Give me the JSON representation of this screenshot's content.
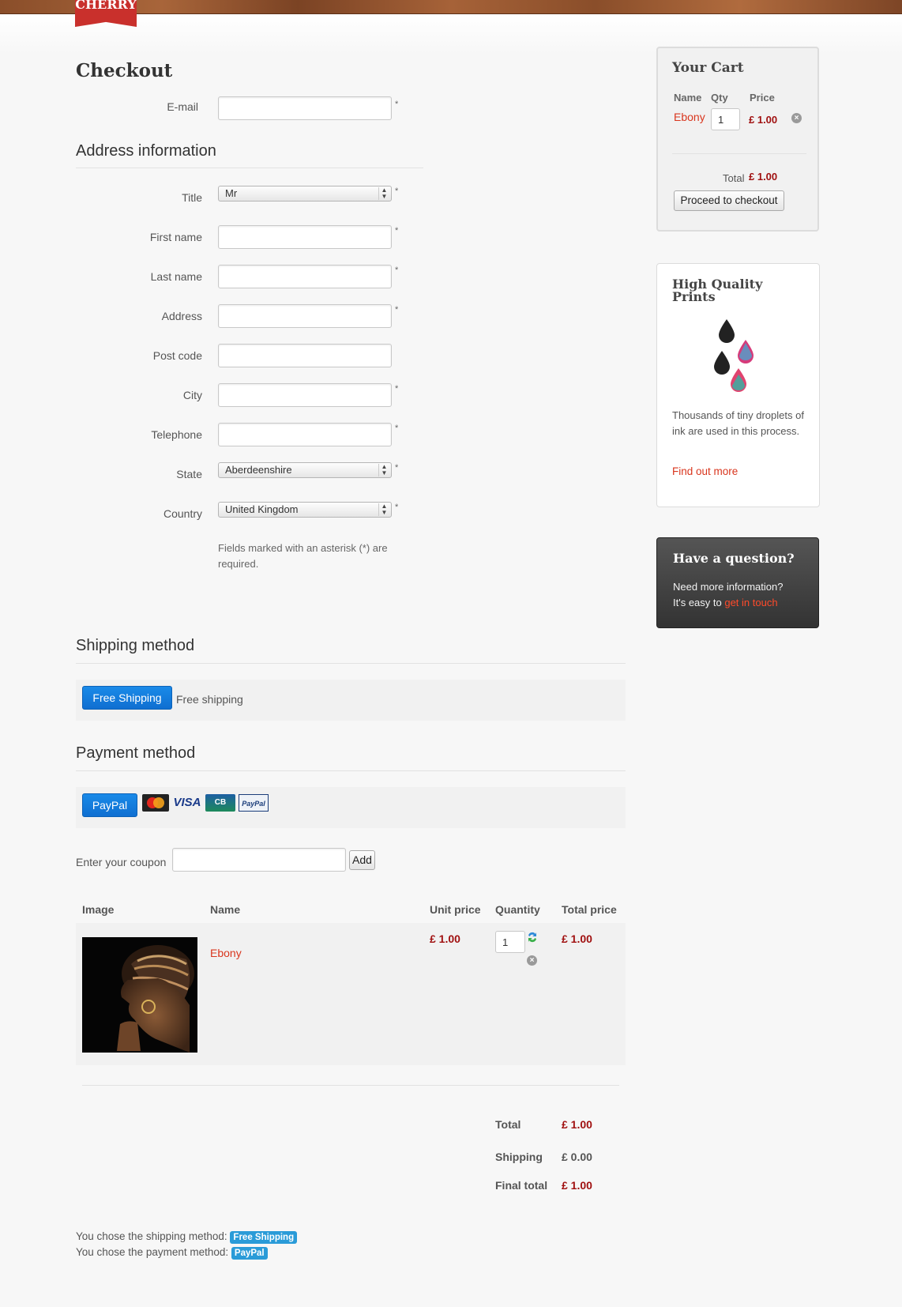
{
  "brand": {
    "logo_text": "CHERRY"
  },
  "checkout": {
    "title": "Checkout",
    "email_label": "E-mail",
    "email_value": ""
  },
  "address": {
    "heading": "Address information",
    "fields": [
      {
        "label": "Title",
        "type": "select",
        "value": "Mr",
        "required": true
      },
      {
        "label": "First name",
        "type": "text",
        "value": "",
        "required": true
      },
      {
        "label": "Last name",
        "type": "text",
        "value": "",
        "required": true
      },
      {
        "label": "Address",
        "type": "text",
        "value": "",
        "required": true
      },
      {
        "label": "Post code",
        "type": "text",
        "value": "",
        "required": false
      },
      {
        "label": "City",
        "type": "text",
        "value": "",
        "required": true
      },
      {
        "label": "Telephone",
        "type": "text",
        "value": "",
        "required": true
      },
      {
        "label": "State",
        "type": "select",
        "value": "Aberdeenshire",
        "required": true
      },
      {
        "label": "Country",
        "type": "select",
        "value": "United Kingdom",
        "required": true
      }
    ],
    "required_mark": "*",
    "required_note": "Fields marked with an asterisk (*) are required."
  },
  "shipping": {
    "heading": "Shipping method",
    "button_label": "Free Shipping",
    "description": "Free shipping"
  },
  "payment": {
    "heading": "Payment method",
    "button_label": "PayPal",
    "card_icons": [
      "mastercard-icon",
      "visa-icon",
      "cb-icon",
      "paypal-card-icon"
    ],
    "visa_text": "VISA",
    "cb_text": "CB",
    "paypal_card_text": "PayPal"
  },
  "coupon": {
    "label": "Enter your coupon",
    "value": "",
    "add_label": "Add"
  },
  "order_table": {
    "headers": {
      "image": "Image",
      "name": "Name",
      "unit_price": "Unit price",
      "quantity": "Quantity",
      "total_price": "Total price"
    },
    "rows": [
      {
        "name": "Ebony",
        "unit_price": "£ 1.00",
        "quantity": "1",
        "total_price": "£ 1.00"
      }
    ]
  },
  "totals": {
    "total_label": "Total",
    "total_value": "£ 1.00",
    "shipping_label": "Shipping",
    "shipping_value": "£ 0.00",
    "final_label": "Final total",
    "final_value": "£ 1.00"
  },
  "summary": {
    "shipping_text": "You chose the shipping method:",
    "shipping_badge": "Free Shipping",
    "payment_text": "You chose the payment method:",
    "payment_badge": "PayPal"
  },
  "cart": {
    "title": "Your Cart",
    "headers": {
      "name": "Name",
      "qty": "Qty",
      "price": "Price"
    },
    "item": {
      "name": "Ebony",
      "qty": "1",
      "price": "£ 1.00"
    },
    "total_label": "Total",
    "total_value": "£ 1.00",
    "checkout_button": "Proceed to checkout"
  },
  "hq_prints": {
    "title": "High Quality Prints",
    "body": "Thousands of tiny droplets of ink are used in this process.",
    "link": "Find out more"
  },
  "question": {
    "title": "Have a question?",
    "line1": "Need more information?",
    "line2_prefix": "It's easy to ",
    "link": "get in touch"
  },
  "colors": {
    "accent_red": "#d9361e",
    "price_red": "#a01010",
    "button_blue": "#1a8ae8",
    "badge_blue": "#2a9bd8"
  }
}
